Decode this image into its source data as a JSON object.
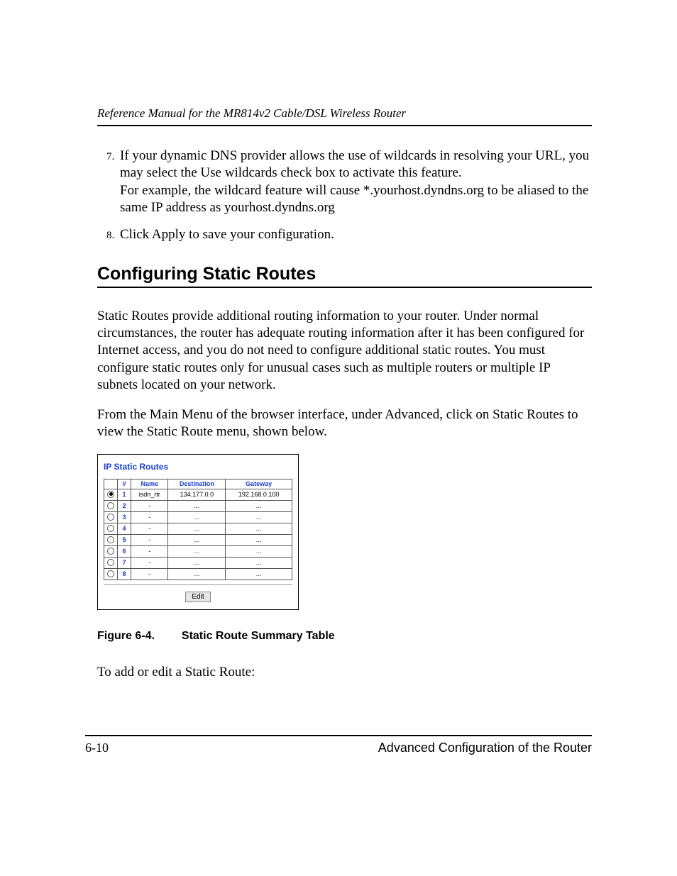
{
  "header": {
    "running_title": "Reference Manual for the MR814v2 Cable/DSL Wireless Router"
  },
  "steps": {
    "start": 7,
    "items": [
      {
        "lines": [
          "If your dynamic DNS provider allows the use of wildcards in resolving your URL, you may select the Use wildcards check box to activate this feature.",
          "For example, the wildcard feature will cause *.yourhost.dyndns.org to be aliased to the same IP address as yourhost.dyndns.org"
        ]
      },
      {
        "lines": [
          "Click Apply to save your configuration."
        ]
      }
    ]
  },
  "section_title": "Configuring Static Routes",
  "para1": "Static Routes provide additional routing information to your router. Under normal circumstances, the router has adequate routing information after it has been configured for Internet access, and you do not need to configure additional static routes. You must configure static routes only for unusual cases such as multiple routers or multiple IP subnets located on your network.",
  "para2": "From the Main Menu of the browser interface, under Advanced, click on Static Routes to view the Static Route menu, shown below.",
  "ui": {
    "title": "IP Static Routes",
    "columns": {
      "num": "#",
      "name": "Name",
      "dest": "Destination",
      "gw": "Gateway"
    },
    "rows": [
      {
        "n": "1",
        "name": "isdn_rtr",
        "dest": "134.177.0.0",
        "gw": "192.168.0.100",
        "selected": true
      },
      {
        "n": "2",
        "name": "-",
        "dest": "...",
        "gw": "...",
        "selected": false
      },
      {
        "n": "3",
        "name": "-",
        "dest": "...",
        "gw": "...",
        "selected": false
      },
      {
        "n": "4",
        "name": "-",
        "dest": "...",
        "gw": "...",
        "selected": false
      },
      {
        "n": "5",
        "name": "-",
        "dest": "...",
        "gw": "...",
        "selected": false
      },
      {
        "n": "6",
        "name": "-",
        "dest": "...",
        "gw": "...",
        "selected": false
      },
      {
        "n": "7",
        "name": "-",
        "dest": "...",
        "gw": "...",
        "selected": false
      },
      {
        "n": "8",
        "name": "-",
        "dest": "...",
        "gw": "...",
        "selected": false
      }
    ],
    "edit_label": "Edit"
  },
  "figure": {
    "number": "Figure 6-4.",
    "caption": "Static Route Summary Table"
  },
  "para3": "To add or edit a Static Route:",
  "footer": {
    "page": "6-10",
    "chapter": "Advanced Configuration of the Router"
  }
}
